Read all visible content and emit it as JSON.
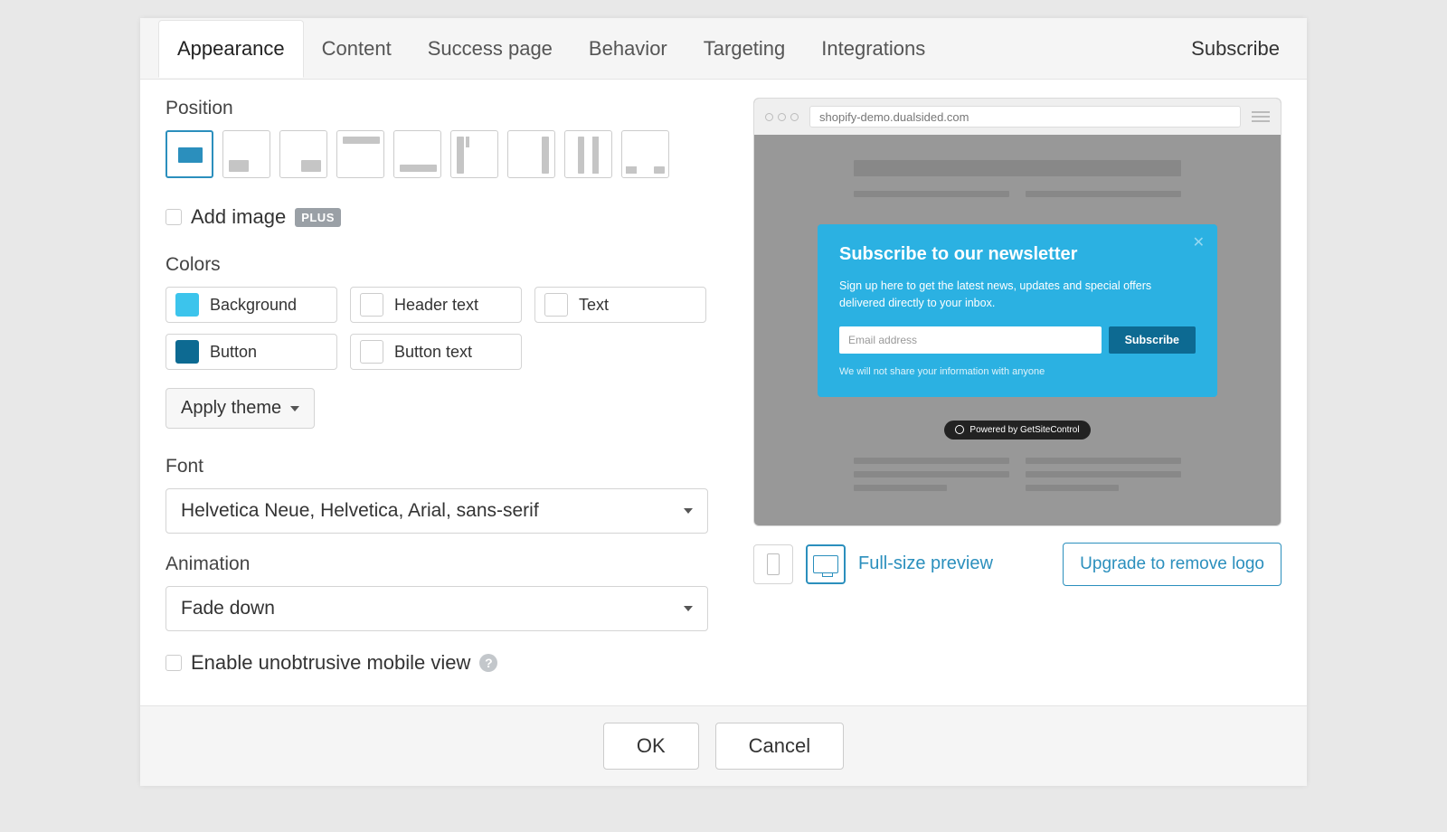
{
  "tabs": {
    "items": [
      "Appearance",
      "Content",
      "Success page",
      "Behavior",
      "Targeting",
      "Integrations"
    ],
    "active": 0,
    "right_label": "Subscribe"
  },
  "position": {
    "label": "Position",
    "selected": 0
  },
  "add_image": {
    "label": "Add image",
    "badge": "PLUS",
    "checked": false
  },
  "colors": {
    "label": "Colors",
    "items": [
      {
        "label": "Background",
        "hex": "#3cc4ec"
      },
      {
        "label": "Header text",
        "hex": "#ffffff"
      },
      {
        "label": "Text",
        "hex": "#ffffff"
      },
      {
        "label": "Button",
        "hex": "#0d6a92"
      },
      {
        "label": "Button text",
        "hex": "#ffffff"
      }
    ]
  },
  "apply_theme": {
    "label": "Apply theme"
  },
  "font": {
    "label": "Font",
    "value": "Helvetica Neue, Helvetica, Arial, sans-serif"
  },
  "animation": {
    "label": "Animation",
    "value": "Fade down"
  },
  "mobile_view": {
    "label": "Enable unobtrusive mobile view",
    "checked": false
  },
  "preview": {
    "url": "shopify-demo.dualsided.com",
    "popup": {
      "heading": "Subscribe to our newsletter",
      "body": "Sign up here to get the latest news, updates and special offers delivered directly to your inbox.",
      "email_placeholder": "Email address",
      "submit_label": "Subscribe",
      "disclaimer": "We will not share your information with anyone"
    },
    "powered": "Powered by GetSiteControl",
    "full_preview": "Full-size preview",
    "upgrade": "Upgrade to remove logo"
  },
  "footer": {
    "ok": "OK",
    "cancel": "Cancel"
  }
}
